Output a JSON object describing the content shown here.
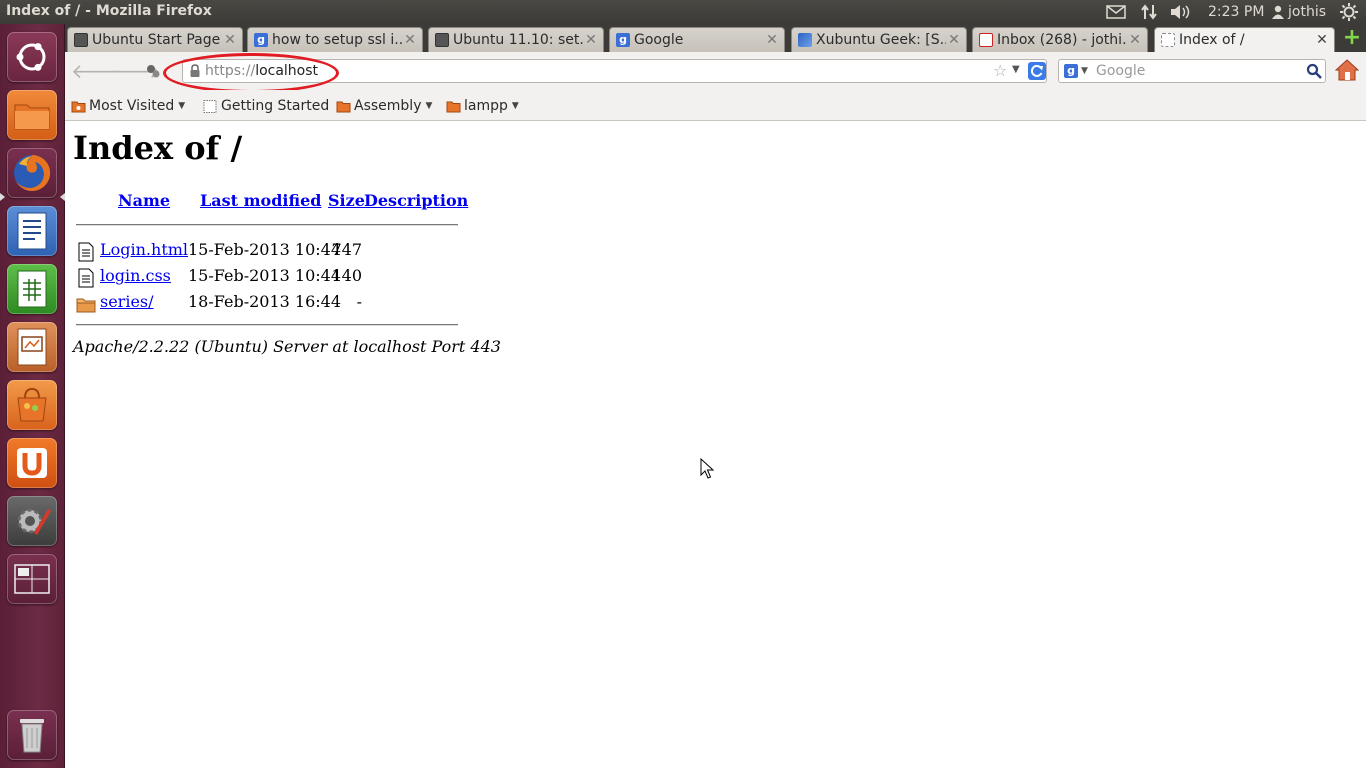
{
  "window": {
    "title": "Index of / - Mozilla Firefox"
  },
  "panel": {
    "clock": "2:23 PM",
    "user": "jothis",
    "icons": [
      "mail-icon",
      "network-icon",
      "sound-icon",
      "user-icon",
      "gear-icon"
    ]
  },
  "launcher": {
    "items": [
      {
        "name": "Dash Home",
        "icon": "ubuntu-logo-icon"
      },
      {
        "name": "Home Folder",
        "icon": "folder-icon"
      },
      {
        "name": "Firefox Web Browser",
        "icon": "firefox-icon"
      },
      {
        "name": "LibreOffice Writer",
        "icon": "writer-icon"
      },
      {
        "name": "LibreOffice Calc",
        "icon": "calc-icon"
      },
      {
        "name": "LibreOffice Impress",
        "icon": "impress-icon"
      },
      {
        "name": "Ubuntu Software Center",
        "icon": "software-center-icon"
      },
      {
        "name": "Ubuntu One",
        "icon": "ubuntu-one-icon"
      },
      {
        "name": "System Settings",
        "icon": "settings-icon"
      },
      {
        "name": "Workspace Switcher",
        "icon": "workspace-icon"
      },
      {
        "name": "Trash",
        "icon": "trash-icon"
      }
    ],
    "active_item": "Firefox Web Browser"
  },
  "tabs": [
    {
      "label": "Ubuntu Start Page",
      "favicon": "blank"
    },
    {
      "label": "how to setup ssl i...",
      "favicon": "google"
    },
    {
      "label": "Ubuntu 11.10: set...",
      "favicon": "blank"
    },
    {
      "label": "Google",
      "favicon": "google"
    },
    {
      "label": "Xubuntu Geek: [S...",
      "favicon": "xubuntu"
    },
    {
      "label": "Inbox (268) - jothi...",
      "favicon": "gmail"
    },
    {
      "label": "Index of /",
      "favicon": "blank",
      "active": true
    }
  ],
  "navigation": {
    "url_scheme": "https://",
    "url_host": "localhost",
    "search_placeholder": "Google"
  },
  "bookmarks": [
    {
      "label": "Most Visited",
      "icon": "most-visited-icon",
      "has_dropdown": true
    },
    {
      "label": "Getting Started",
      "icon": "page-icon",
      "has_dropdown": false
    },
    {
      "label": "Assembly",
      "icon": "folder-icon",
      "has_dropdown": true
    },
    {
      "label": "lampp",
      "icon": "folder-icon",
      "has_dropdown": true
    }
  ],
  "page": {
    "title": "Index of /",
    "columns": [
      "Name",
      "Last modified",
      "Size",
      "Description"
    ],
    "rows": [
      {
        "name": "Login.html",
        "modified": "15-Feb-2013 10:44",
        "size": "747",
        "description": "",
        "type": "file"
      },
      {
        "name": "login.css",
        "modified": "15-Feb-2013 10:44",
        "size": "140",
        "description": "",
        "type": "file"
      },
      {
        "name": "series/",
        "modified": "18-Feb-2013 16:44",
        "size": "-",
        "description": "",
        "type": "folder"
      }
    ],
    "signature": "Apache/2.2.22 (Ubuntu) Server at localhost Port 443"
  },
  "colors": {
    "panel_bg": "#3c3b37",
    "launcher_bg": "#6d2a44",
    "link": "#0000ee",
    "highlight_ellipse": "#e01b22"
  }
}
